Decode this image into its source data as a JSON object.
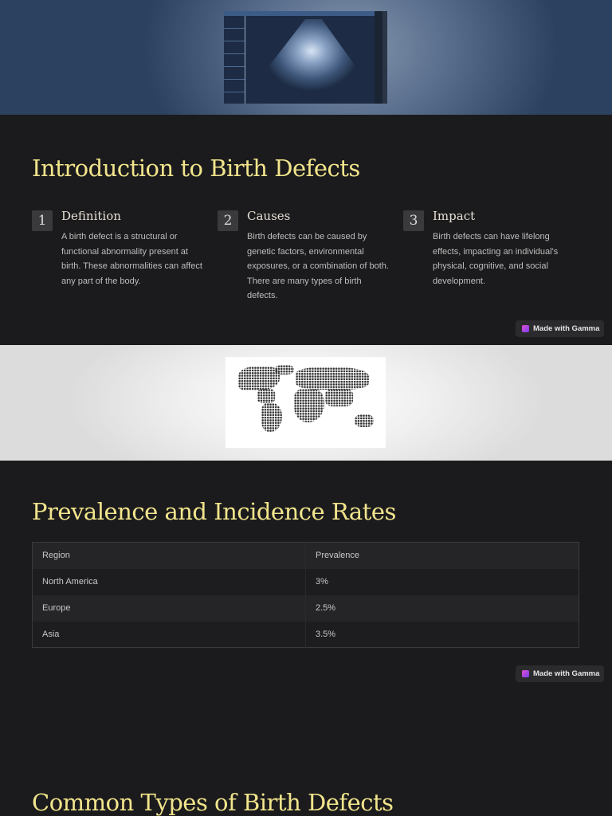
{
  "slide1": {
    "title": "Introduction to Birth Defects",
    "items": [
      {
        "number": "1",
        "heading": "Definition",
        "text": "A birth defect is a structural or functional abnormality present at birth. These abnormalities can affect any part of the body."
      },
      {
        "number": "2",
        "heading": "Causes",
        "text": "Birth defects can be caused by genetic factors, environmental exposures, or a combination of both. There are many types of birth defects."
      },
      {
        "number": "3",
        "heading": "Impact",
        "text": "Birth defects can have lifelong effects, impacting an individual's physical, cognitive, and social development."
      }
    ],
    "badge": "Made with Gamma"
  },
  "slide2": {
    "title": "Prevalence and Incidence Rates",
    "table": {
      "headers": [
        "Region",
        "Prevalence"
      ],
      "rows": [
        [
          "North America",
          "3%"
        ],
        [
          "Europe",
          "2.5%"
        ],
        [
          "Asia",
          "3.5%"
        ]
      ]
    },
    "badge": "Made with Gamma"
  },
  "slide3": {
    "title": "Common Types of Birth Defects"
  },
  "colors": {
    "title": "#f2e58c",
    "background": "#1b1b1d",
    "badge_icon": "#c04ee0"
  }
}
